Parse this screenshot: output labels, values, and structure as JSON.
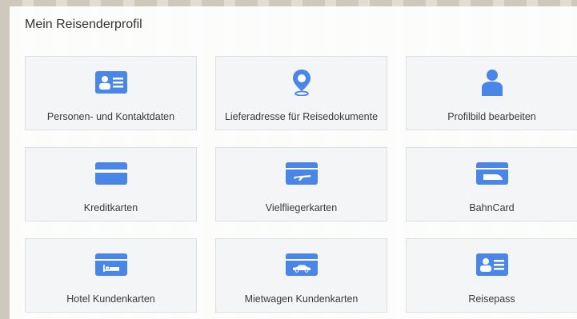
{
  "title": "Mein Reisenderprofil",
  "accent_color": "#4a86e8",
  "cards": [
    {
      "label": "Personen- und Kontaktdaten",
      "icon": "contact-card-icon"
    },
    {
      "label": "Lieferadresse für Reisedokumente",
      "icon": "map-pin-icon"
    },
    {
      "label": "Profilbild bearbeiten",
      "icon": "user-icon"
    },
    {
      "label": "Kreditkarten",
      "icon": "credit-card-icon"
    },
    {
      "label": "Vielfliegerkarten",
      "icon": "airplane-card-icon"
    },
    {
      "label": "BahnCard",
      "icon": "train-card-icon"
    },
    {
      "label": "Hotel Kundenkarten",
      "icon": "hotel-card-icon"
    },
    {
      "label": "Mietwagen Kundenkarten",
      "icon": "car-card-icon"
    },
    {
      "label": "Reisepass",
      "icon": "passport-card-icon"
    }
  ]
}
